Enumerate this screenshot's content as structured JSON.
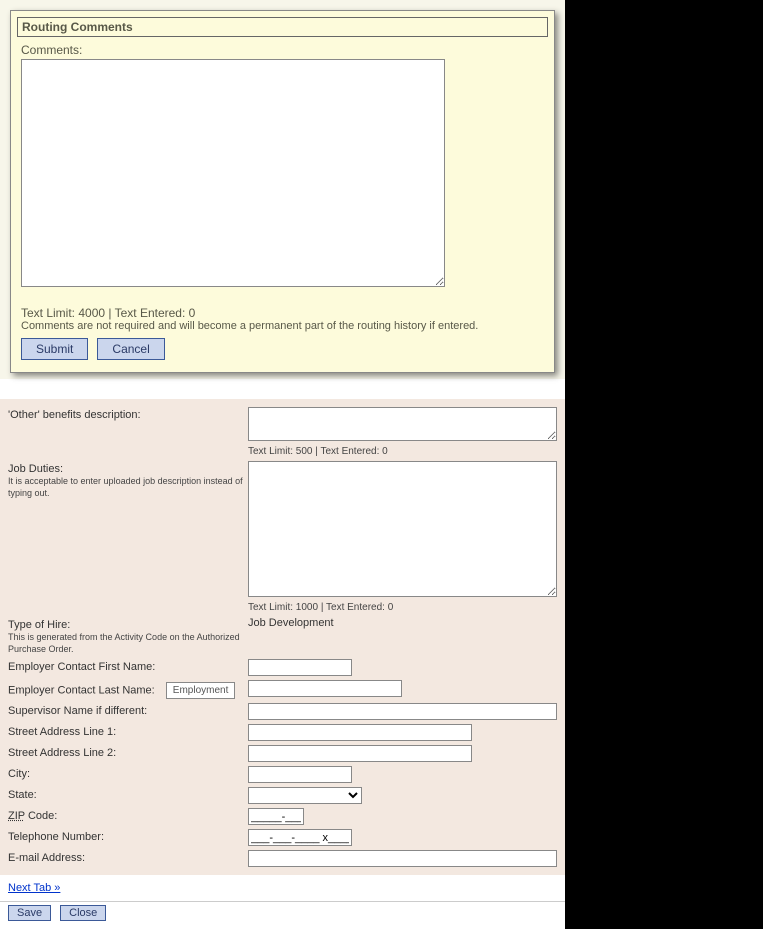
{
  "routing": {
    "panel_title": "Routing Comments",
    "comments_label": "Comments:",
    "comment_value": "",
    "limit_text": "Text Limit: 4000 | Text Entered: 0",
    "note_text": "Comments are not required and will become a permanent part of the routing history if entered.",
    "submit_label": "Submit",
    "cancel_label": "Cancel"
  },
  "form": {
    "other_benefits": {
      "label": "'Other' benefits description:",
      "value": "",
      "limit": "Text Limit: 500 | Text Entered: 0"
    },
    "job_duties": {
      "label": "Job Duties:",
      "helper": "It is acceptable to enter uploaded job description instead of typing out.",
      "value": "",
      "limit": "Text Limit: 1000 | Text Entered: 0"
    },
    "type_of_hire": {
      "label": "Type of Hire:",
      "helper": "This is generated from the Activity Code on the Authorized Purchase Order.",
      "value": "Job Development"
    },
    "employer_first": {
      "label": "Employer Contact First Name:",
      "value": ""
    },
    "employer_last": {
      "label": "Employer Contact Last Name:",
      "value": "",
      "tag": "Employment"
    },
    "supervisor": {
      "label": "Supervisor Name if different:",
      "value": ""
    },
    "street1": {
      "label": "Street Address Line 1:",
      "value": ""
    },
    "street2": {
      "label": "Street Address Line 2:",
      "value": ""
    },
    "city": {
      "label": "City:",
      "value": ""
    },
    "state": {
      "label": "State:",
      "value": ""
    },
    "zip": {
      "label_prefix": "ZIP",
      "label_suffix": " Code:",
      "value": "_____-____"
    },
    "phone": {
      "label": "Telephone Number:",
      "value": "___-___-____ x_____"
    },
    "email": {
      "label": "E-mail Address:",
      "value": ""
    }
  },
  "footer": {
    "next_tab": "Next Tab »",
    "save": "Save",
    "close": "Close"
  }
}
